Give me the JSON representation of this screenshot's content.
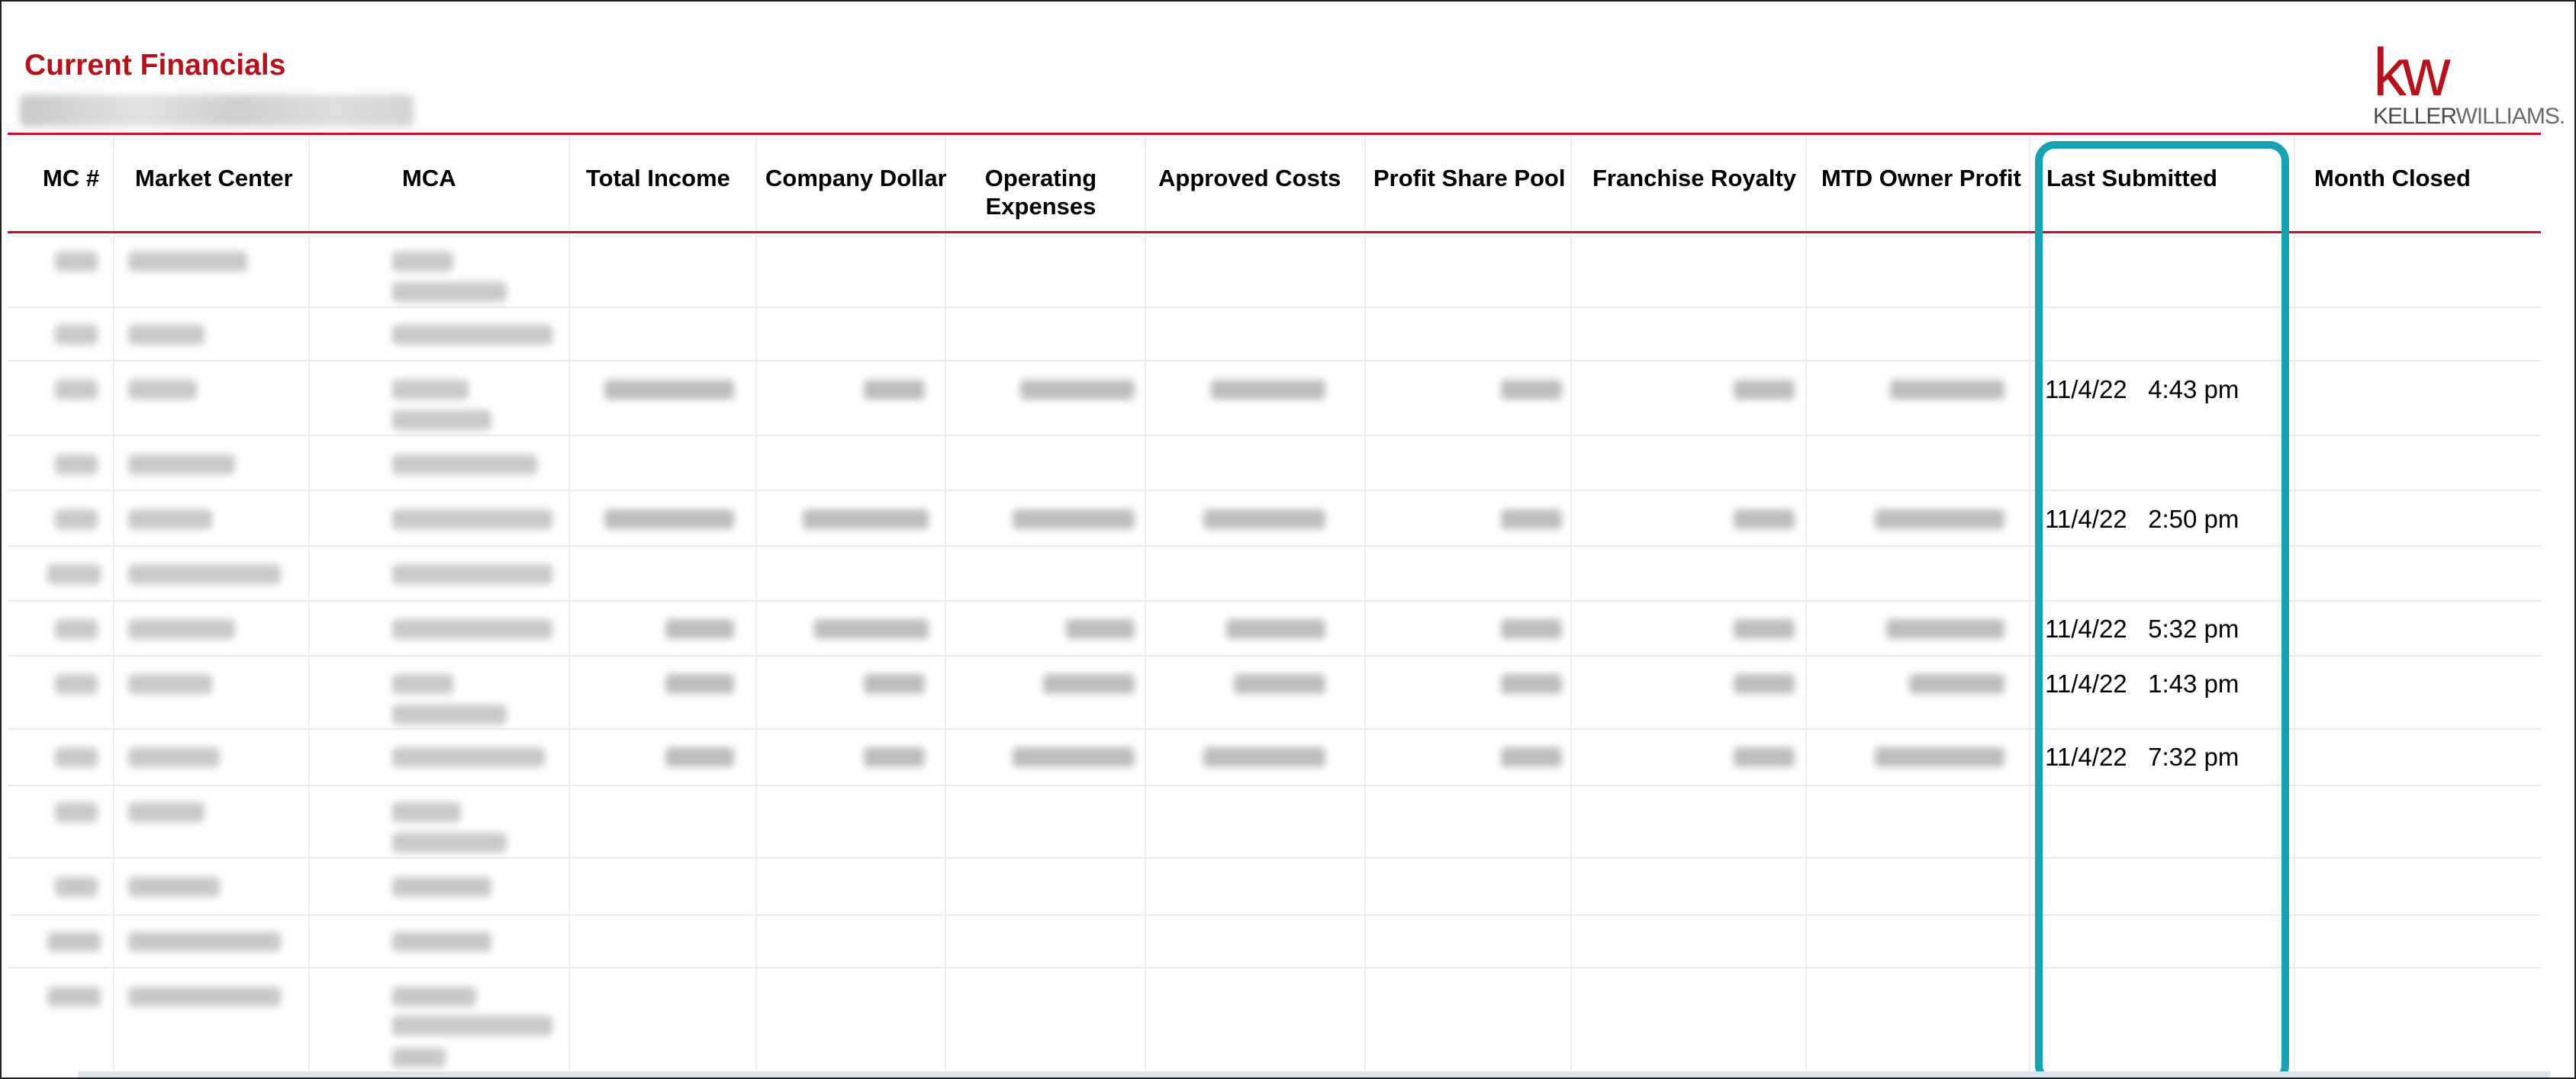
{
  "report": {
    "title": "Current Financials"
  },
  "logo": {
    "mark": "kw",
    "name_part1": "KELLER",
    "name_part2": "WILLIAMS."
  },
  "table": {
    "headers": {
      "mc": "MC #",
      "market_center": "Market Center",
      "mca": "MCA",
      "total_income": "Total Income",
      "company_dollar": "Company Dollar",
      "operating_expenses_1": "Operating",
      "operating_expenses_2": "Expenses",
      "approved_costs": "Approved Costs",
      "profit_share_pool": "Profit Share Pool",
      "franchise_royalty": "Franchise Royalty",
      "mtd_owner_profit": "MTD Owner Profit",
      "last_submitted": "Last Submitted",
      "month_closed": "Month Closed"
    },
    "last_submitted_values": [
      "",
      "",
      "11/4/22   4:43 pm",
      "",
      "11/4/22   2:50 pm",
      "",
      "11/4/22   5:32 pm",
      "11/4/22   1:43 pm",
      "11/4/22   7:32 pm",
      "",
      "",
      "",
      ""
    ]
  },
  "colors": {
    "brand_red": "#b5121b",
    "highlight_teal": "#17a2b1"
  }
}
